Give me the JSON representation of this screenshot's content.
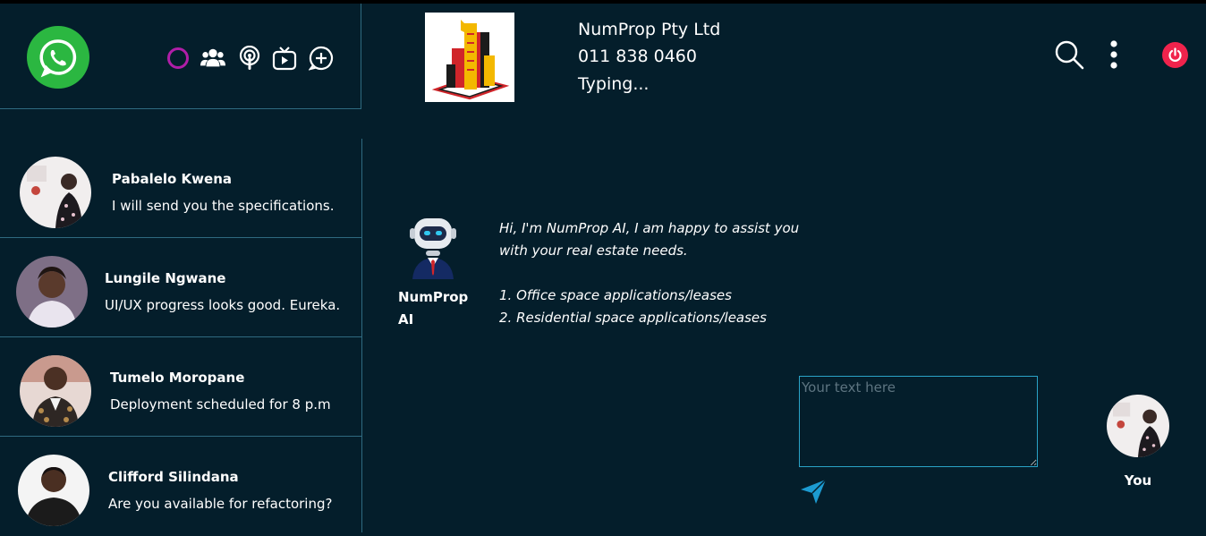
{
  "app": {
    "logo_icon": "whatsapp-logo"
  },
  "header_icons": [
    {
      "name": "status-icon"
    },
    {
      "name": "communities-icon"
    },
    {
      "name": "channels-icon"
    },
    {
      "name": "video-icon"
    },
    {
      "name": "new-chat-icon"
    }
  ],
  "chats": [
    {
      "name": "Pabalelo Kwena",
      "message": "I will send you the specifications."
    },
    {
      "name": "Lungile Ngwane",
      "message": "UI/UX progress looks good. Eureka."
    },
    {
      "name": "Tumelo Moropane",
      "message": "Deployment scheduled for 8 p.m"
    },
    {
      "name": "Clifford Silindana",
      "message": "Are you available for refactoring?"
    }
  ],
  "contact": {
    "name": "NumProp Pty Ltd",
    "phone": "011 838 0460",
    "status": "Typing..."
  },
  "bot": {
    "name": "NumProp AI",
    "messages": [
      "Hi, I'm NumProp AI, I am happy to assist you with your real estate needs.",
      "1. Office space applications/leases",
      "2. Residential space applications/leases"
    ]
  },
  "composer": {
    "placeholder": "Your text here"
  },
  "me": {
    "label": "You"
  },
  "colors": {
    "background": "#041e2b",
    "divider": "#2f6a80",
    "whatsapp_green": "#2bb741",
    "status_ring": "#b01ea8",
    "power_red": "#f0234c",
    "send_blue": "#1c9bd1"
  }
}
